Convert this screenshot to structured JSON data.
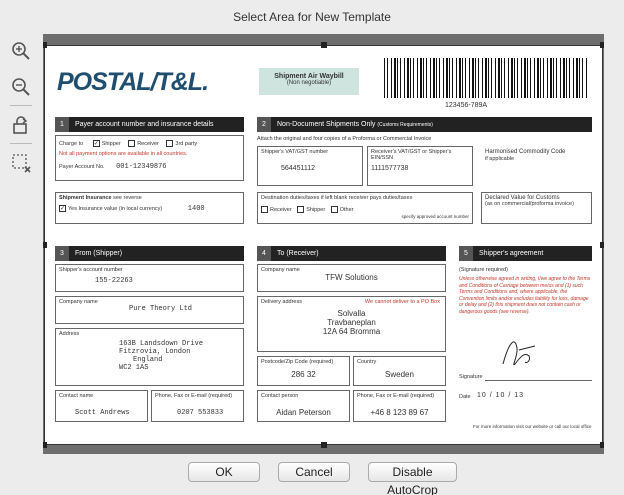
{
  "window": {
    "title": "Select Area for New Template"
  },
  "tools": [
    {
      "name": "zoom-in-icon"
    },
    {
      "name": "zoom-out-icon"
    },
    {
      "name": "rotate-icon"
    },
    {
      "name": "clear-selection-icon"
    }
  ],
  "doc": {
    "logo": "POSTAL/T&L.",
    "waybill_title": "Shipment Air Waybill",
    "waybill_sub": "(Non negotiable)",
    "barcode_number": "123456-789A",
    "s1": {
      "num": "1",
      "title": "Payer account number and insurance details",
      "charge_to": "Charge to",
      "opt_shipper": "Shipper",
      "opt_receiver": "Receiver",
      "opt_third": "3rd party",
      "note": "Not all payment options are available in all countries.",
      "account_label": "Payer Account No.",
      "account_value": "001-12349876",
      "insurance_label": "Shipment Insurance",
      "insurance_hint": "see reverse",
      "insurance_yes": "Yes Insurance value (in local currency)",
      "insurance_value": "1400"
    },
    "s2": {
      "num": "2",
      "title": "Non-Document Shipments Only",
      "title_small": "(Customs Requirements)",
      "attach_note": "Attach the original and four copies of a Proforma or Commercial Invoice",
      "vat_shipper_label": "Shipper's VAT/GST number",
      "vat_shipper_value": "564451112",
      "vat_receiver_label": "Receiver's VAT/GST or Shipper's EIN/SSN",
      "vat_receiver_value": "1111577738",
      "hs_label": "Harmonised Commodity Code",
      "hs_sub": "if applicable",
      "duties_label": "Destination duties/taxes if left blank receiver pays duties/taxes",
      "opt_receiver": "Receiver",
      "opt_shipper": "Shipper",
      "opt_other": "Other",
      "approved": "specify approved account number",
      "customs_label": "Declared Value for Customs",
      "customs_sub": "(as on commercial/proforma invoice)"
    },
    "s3": {
      "num": "3",
      "title": "From (Shipper)",
      "account_label": "Shipper's account number",
      "account_value": "155-22263",
      "company_label": "Company name",
      "company_value": "Pure Theory Ltd",
      "address_label": "Address",
      "address_lines": [
        "163B Landsdown Drive",
        "Fitzrovia, London",
        "England",
        "WC2 1AS"
      ],
      "contact_label": "Contact name",
      "contact_value": "Scott Andrews",
      "phone_label": "Phone, Fax or E-mail",
      "phone_req": "(required)",
      "phone_value": "0207 553833"
    },
    "s4": {
      "num": "4",
      "title": "To (Receiver)",
      "company_label": "Company name",
      "company_value": "TFW Solutions",
      "delivery_label": "Delivery address",
      "po_note": "We cannot deliver to a PO Box",
      "address_lines": [
        "Solvalla",
        "Travbaneplan",
        "12A 64 Bromma"
      ],
      "postcode_label": "Postcode/Zip Code",
      "postcode_req": "(required)",
      "postcode_value": "286 32",
      "country_label": "Country",
      "country_value": "Sweden",
      "contact_label": "Contact person",
      "contact_value": "Aidan Peterson",
      "phone_label": "Phone, Fax or E-mail",
      "phone_req": "(required)",
      "phone_value": "+46 8 123 89 67"
    },
    "s5": {
      "num": "5",
      "title": "Shipper's agreement",
      "sig_required": "(Signature required)",
      "terms": "Unless otherwise agreed in writing, I/we agree to the Terms and Conditions of Carriage between me/us and (1) such Terms and Conditions and, where applicable, the Convention limits and/or excludes liability for loss, damage or delay and (2) this shipment does not contain cash or dangerous goods (see reverse).",
      "signature_label": "Signature",
      "date_label": "Date",
      "date_value": "10 / 10 / 13",
      "footer": "For more information visit our website or call our local office"
    }
  },
  "buttons": {
    "ok": "OK",
    "cancel": "Cancel",
    "autocrop": "Disable AutoCrop"
  }
}
